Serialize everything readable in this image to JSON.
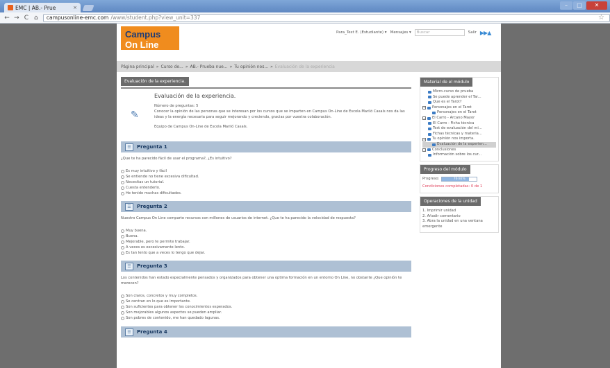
{
  "browser": {
    "tab_title": "EMC | AB.- Prue",
    "tab_close": "×",
    "url_host": "campusonline-emc.com",
    "url_path": "/www/student.php?view_unit=337",
    "back": "←",
    "forward": "→",
    "reload": "C",
    "home": "⌂",
    "star": "☆"
  },
  "header": {
    "logo_line1_a": "Campus ",
    "logo_line1_b": "On Line",
    "logo_line2": "de la Escola Mariló Casals",
    "user_menu": "Para_Test E. (Estudiante) ▾",
    "messages_menu": "Mensajes ▾",
    "search_placeholder": "Buscar",
    "logout": "Salir",
    "arrows": "▶▶▲"
  },
  "breadcrumb": {
    "items": [
      "Página principal",
      "Curso de...",
      "AB.- Prueba nue...",
      "Tu opinión nos..."
    ],
    "current": "Evaluación de la experiencia",
    "separator": "»"
  },
  "main": {
    "tab_label": "Evaluación de la experiencia.",
    "title": "Evaluación de la experiencia.",
    "num_questions": "Número de preguntas: 5",
    "description": "Conocer la opinión de las personas que se interesan por los cursos que se imparten en Campus On-Line de Escola Mariló Casals nos da las ideas y la energía necesaria para seguir mejorando y creciendo, gracias por vuestra colaboración.",
    "team": "Equipo de Campus On-Line de Escola Mariló Casals.",
    "questions": [
      {
        "label": "Pregunta 1",
        "text": "¿Que te ha parecido fácil de usar el programa?, ¿Es intuitivo?",
        "options": [
          "Es muy intuitivo y fácil",
          "Se entiende no tiene excesiva dificultad.",
          "Necesitas un tutorial.",
          "Cuesta entenderlo.",
          "He tenido muchas dificultades."
        ]
      },
      {
        "label": "Pregunta 2",
        "text": "Nuestro Campus On Line comparte recursos con millones de usuarios de internet. ¿Que te ha parecido la velocidad de respuesta?",
        "options": [
          "Muy buena.",
          "Buena.",
          "Mejorable, pero te permite trabajar.",
          "A veces es excesivamente lento.",
          "Es tan lento que a veces lo tengo que dejar."
        ]
      },
      {
        "label": "Pregunta 3",
        "text": "Los contenidos han estado especialmente pensados y organizados para obtener una optima formación en un entorno On Line, no obstante ¿Que opinión te merecen?",
        "options": [
          "Son claros, concretos y muy completos.",
          "Se centran en lo que es importante.",
          "Son suficientes para obtener los conocimientos esperados.",
          "Son mejorables algunos aspectos se pueden ampliar.",
          "Son pobres de contenido, me han quedado lagunas."
        ]
      },
      {
        "label": "Pregunta 4",
        "text": "",
        "options": []
      }
    ]
  },
  "sidebar": {
    "material": {
      "title": "Material de el módulo",
      "items": [
        {
          "label": "Micro-curso de prueba",
          "level": 1,
          "toggle": ""
        },
        {
          "label": "Se puede aprender el Tar...",
          "level": 1,
          "toggle": ""
        },
        {
          "label": "Que es el Tarot?",
          "level": 1,
          "toggle": ""
        },
        {
          "label": "Personajes en el Tarot",
          "level": 0,
          "toggle": "−"
        },
        {
          "label": "Personajes en el Tarot",
          "level": 2,
          "toggle": ""
        },
        {
          "label": "El Carro - Arcano Mayor",
          "level": 0,
          "toggle": "−"
        },
        {
          "label": "El Carro - Ficha técnica",
          "level": 1,
          "toggle": ""
        },
        {
          "label": "Test de evaluación del mi...",
          "level": 1,
          "toggle": ""
        },
        {
          "label": "Fichas técnicas y materia...",
          "level": 1,
          "toggle": ""
        },
        {
          "label": "Tu opinión nos importa.",
          "level": 0,
          "toggle": "−"
        },
        {
          "label": "Evaluación de la experien...",
          "level": 2,
          "toggle": "",
          "selected": true
        },
        {
          "label": "Conclusiones",
          "level": 0,
          "toggle": "−"
        },
        {
          "label": "Información sobre los cur...",
          "level": 1,
          "toggle": ""
        }
      ]
    },
    "progress": {
      "title": "Progreso del módulo",
      "label": "Progreso:",
      "percent_text": "76.92%",
      "percent": 76.92,
      "conditions": "Condiciones completadas: 0 de 1"
    },
    "operations": {
      "title": "Operaciones de la unidad",
      "items": [
        "1. Imprimir unidad",
        "2. Añadir comentario",
        "3. Abra la unidad en una ventana emergente"
      ]
    }
  },
  "colors": {
    "accent": "#f08c1e",
    "question_header": "#aec0d4",
    "dark_tab": "#6b6b6b",
    "alert": "#e0405a"
  }
}
